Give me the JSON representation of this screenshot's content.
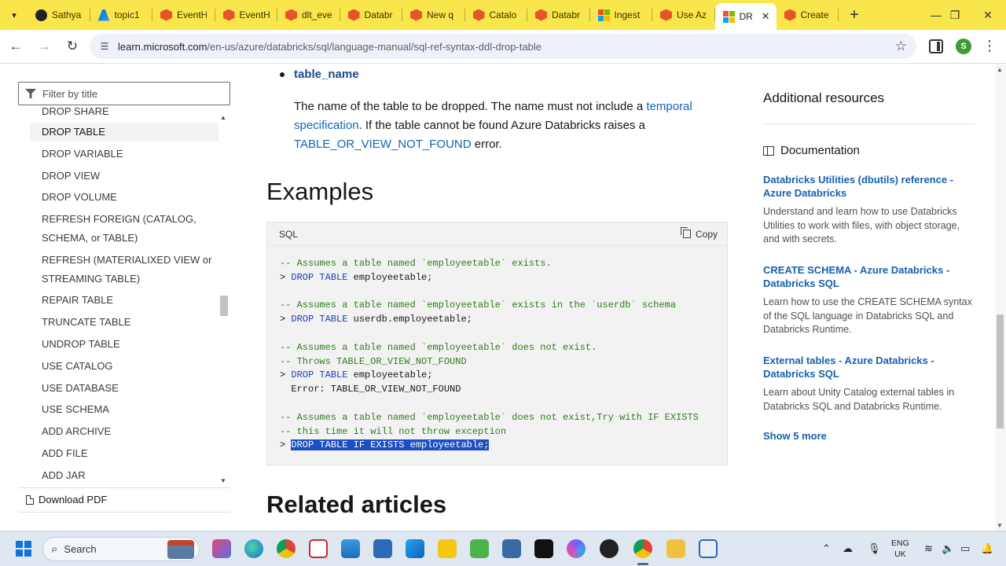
{
  "browser": {
    "tabs": [
      {
        "title": "Sathya",
        "icon": "github-icon"
      },
      {
        "title": "topic1",
        "icon": "azure-icon"
      },
      {
        "title": "EventH",
        "icon": "databricks-icon"
      },
      {
        "title": "EventH",
        "icon": "databricks-icon"
      },
      {
        "title": "dlt_eve",
        "icon": "databricks-icon"
      },
      {
        "title": "Databr",
        "icon": "databricks-icon"
      },
      {
        "title": "New q",
        "icon": "databricks-icon"
      },
      {
        "title": "Catalo",
        "icon": "databricks-icon"
      },
      {
        "title": "Databr",
        "icon": "databricks-icon"
      },
      {
        "title": "Ingest",
        "icon": "microsoft-icon"
      },
      {
        "title": "Use Az",
        "icon": "databricks-icon"
      },
      {
        "title": "DR",
        "icon": "microsoft-icon",
        "active": true
      },
      {
        "title": "Create",
        "icon": "databricks-icon"
      }
    ],
    "url_host": "learn.microsoft.com",
    "url_path": "/en-us/azure/databricks/sql/language-manual/sql-ref-syntax-ddl-drop-table",
    "profile_initial": "S"
  },
  "sidebar": {
    "filter_placeholder": "Filter by title",
    "partial_item": "DROP SHARE",
    "items": [
      {
        "label": "DROP TABLE",
        "active": true
      },
      {
        "label": "DROP VARIABLE"
      },
      {
        "label": "DROP VIEW"
      },
      {
        "label": "DROP VOLUME"
      },
      {
        "label": "REFRESH FOREIGN (CATALOG,"
      },
      {
        "label": "SCHEMA, or TABLE)"
      },
      {
        "label": "REFRESH (MATERIALIXED VIEW or"
      },
      {
        "label": "STREAMING TABLE)"
      },
      {
        "label": "REPAIR TABLE"
      },
      {
        "label": "TRUNCATE TABLE"
      },
      {
        "label": "UNDROP TABLE"
      },
      {
        "label": "USE CATALOG"
      },
      {
        "label": "USE DATABASE"
      },
      {
        "label": "USE SCHEMA"
      },
      {
        "label": "ADD ARCHIVE"
      },
      {
        "label": "ADD FILE"
      },
      {
        "label": "ADD JAR"
      }
    ],
    "download_pdf": "Download PDF"
  },
  "main": {
    "param_name": "table_name",
    "desc_1": "The name of the table to be dropped. The name must not include a ",
    "desc_link_1": "temporal specification",
    "desc_2": ". If the table cannot be found Azure Databricks raises a ",
    "desc_link_2": "TABLE_OR_VIEW_NOT_FOUND",
    "desc_3": " error.",
    "examples_heading": "Examples",
    "code_lang": "SQL",
    "copy_label": "Copy",
    "code_lines": [
      {
        "c": "-- Assumes a table named `employeetable` exists."
      },
      {
        "p": "> ",
        "k": "DROP TABLE",
        "t": " employeetable;"
      },
      {
        "t": ""
      },
      {
        "c": "-- Assumes a table named `employeetable` exists in the `userdb` schema"
      },
      {
        "p": "> ",
        "k": "DROP TABLE",
        "t": " userdb.employeetable;"
      },
      {
        "t": ""
      },
      {
        "c": "-- Assumes a table named `employeetable` does not exist."
      },
      {
        "c": "-- Throws TABLE_OR_VIEW_NOT_FOUND"
      },
      {
        "p": "> ",
        "k": "DROP TABLE",
        "t": " employeetable;"
      },
      {
        "t": "  Error: TABLE_OR_VIEW_NOT_FOUND"
      },
      {
        "t": ""
      },
      {
        "c": "-- Assumes a table named `employeetable` does not exist,Try with IF EXISTS"
      },
      {
        "c": "-- this time it will not throw exception"
      },
      {
        "p": "> ",
        "h": "DROP TABLE IF EXISTS employeetable;"
      }
    ],
    "related_heading": "Related articles"
  },
  "rail": {
    "title": "Additional resources",
    "section": "Documentation",
    "links": [
      {
        "title": "Databricks Utilities (dbutils) reference - Azure Databricks",
        "desc": "Understand and learn how to use Databricks Utilities to work with files, with object storage, and with secrets."
      },
      {
        "title": "CREATE SCHEMA - Azure Databricks - Databricks SQL",
        "desc": "Learn how to use the CREATE SCHEMA syntax of the SQL language in Databricks SQL and Databricks Runtime."
      },
      {
        "title": "External tables - Azure Databricks - Databricks SQL",
        "desc": "Learn about Unity Catalog external tables in Databricks SQL and Databricks Runtime."
      }
    ],
    "show_more": "Show 5 more"
  },
  "taskbar": {
    "search_label": "Search",
    "lang_top": "ENG",
    "lang_bottom": "UK"
  }
}
